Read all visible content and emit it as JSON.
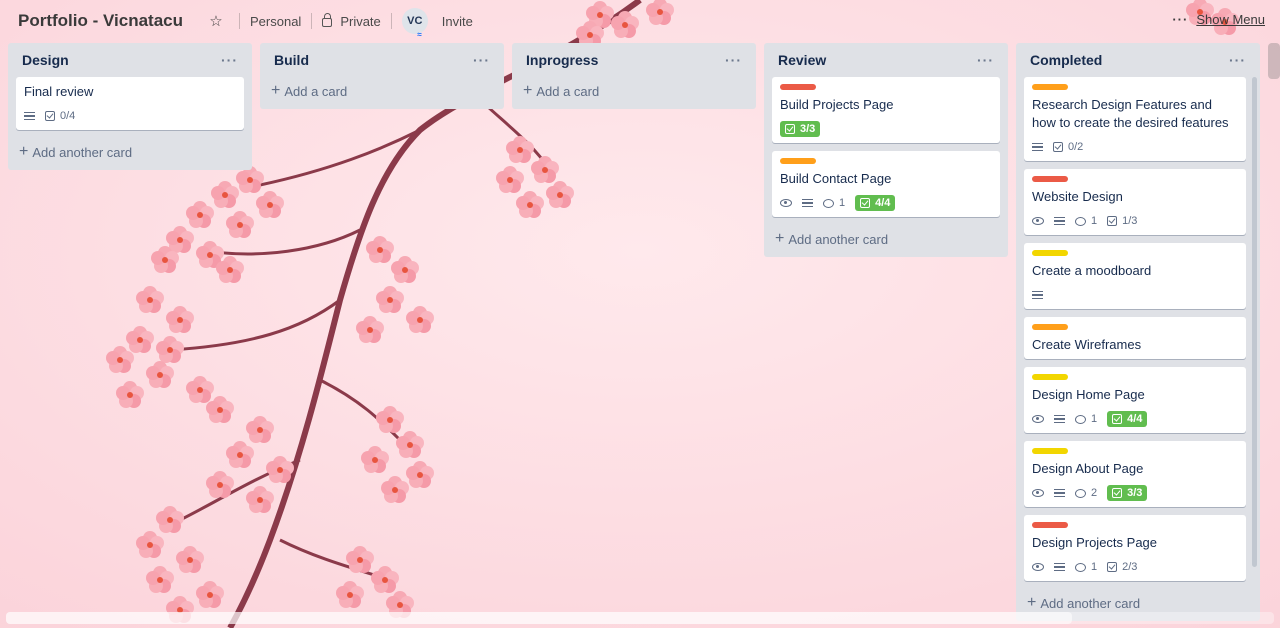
{
  "header": {
    "board_title": "Portfolio - Vicnatacu",
    "workspace": "Personal",
    "visibility": "Private",
    "avatar_initials": "VC",
    "invite": "Invite",
    "show_menu": "Show Menu"
  },
  "lists": {
    "design": {
      "title": "Design",
      "add": "Add another card",
      "cards": [
        {
          "title": "Final review",
          "checklist": "0/4"
        }
      ]
    },
    "build": {
      "title": "Build",
      "add": "Add a card"
    },
    "inprogress": {
      "title": "Inprogress",
      "add": "Add a card"
    },
    "review": {
      "title": "Review",
      "add": "Add another card",
      "cards": [
        {
          "title": "Build Projects Page",
          "label_color": "#eb5a46",
          "checklist": "3/3"
        },
        {
          "title": "Build Contact Page",
          "label_color": "#ff9f1a",
          "comments": "1",
          "checklist": "4/4"
        }
      ]
    },
    "completed": {
      "title": "Completed",
      "add": "Add another card",
      "cards": [
        {
          "title": "Research Design Features and how to create the desired features",
          "label_color": "#ff9f1a",
          "checklist": "0/2"
        },
        {
          "title": "Website Design",
          "label_color": "#eb5a46",
          "comments": "1",
          "checklist": "1/3"
        },
        {
          "title": "Create a moodboard",
          "label_color": "#f2d600"
        },
        {
          "title": "Create Wireframes",
          "label_color": "#ff9f1a"
        },
        {
          "title": "Design Home Page",
          "label_color": "#f2d600",
          "comments": "1",
          "checklist": "4/4"
        },
        {
          "title": "Design About Page",
          "label_color": "#f2d600",
          "comments": "2",
          "checklist": "3/3"
        },
        {
          "title": "Design Projects Page",
          "label_color": "#eb5a46",
          "comments": "1",
          "checklist": "2/3"
        }
      ]
    }
  },
  "colors": {
    "list_bg": "#dfe1e6",
    "done_green": "#61bd4f",
    "label_red": "#eb5a46",
    "label_orange": "#ff9f1a",
    "label_yellow": "#f2d600"
  },
  "icons": [
    "star-icon",
    "lock-icon",
    "more-icon",
    "description-icon",
    "checklist-icon",
    "eye-icon",
    "comment-icon",
    "plus-icon"
  ]
}
